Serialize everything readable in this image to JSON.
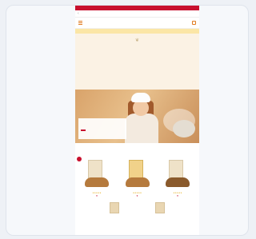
{
  "browser": {
    "topbar_text": "",
    "url": ""
  },
  "site": {
    "logo": "",
    "logo_sub": "",
    "promo": ""
  },
  "intro": {
    "title": "",
    "subtitle": "",
    "body": ""
  },
  "hero": {
    "title": "",
    "description": "",
    "button_label": ""
  },
  "section": {
    "title": "",
    "text": ""
  },
  "products": [
    {
      "badge": "",
      "name": "",
      "stars": "★★★★★",
      "price": "",
      "meta": "",
      "fav": "♥"
    },
    {
      "badge": "",
      "name": "",
      "stars": "★★★★★",
      "price": "",
      "meta": "",
      "fav": "♥"
    },
    {
      "badge": "",
      "name": "",
      "stars": "★★★★★",
      "price": "",
      "meta": "",
      "fav": "♥"
    }
  ],
  "colors": {
    "brand": "#c8102e",
    "accent": "#e07a1f",
    "promo_bg": "#fbe6a6",
    "intro_bg": "#fbf2e4"
  },
  "icons": [
    "menu-icon",
    "cart-icon",
    "back-icon",
    "heart-icon",
    "star-icon"
  ]
}
